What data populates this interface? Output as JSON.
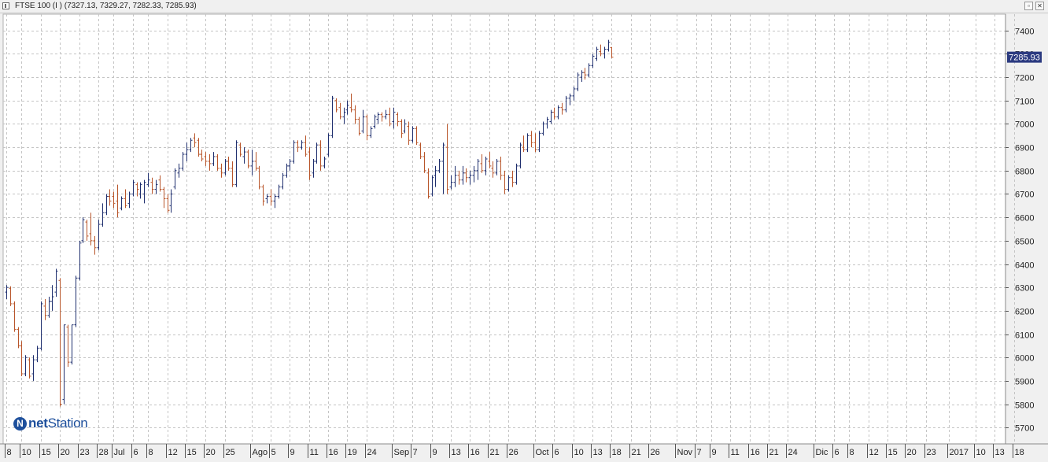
{
  "window": {
    "title": "FTSE 100 (I ) (7327.13, 7329.27, 7282.33, 7285.93)",
    "restore_glyph": "▫",
    "close_glyph": "✕"
  },
  "logo": {
    "mark": "N",
    "text_bold": "net",
    "text_rest": "Station"
  },
  "colors": {
    "up": "#1f2f6e",
    "down": "#b8552a",
    "grid": "#c4c4c4",
    "last_price_bg": "#2b3a80"
  },
  "chart_data": {
    "type": "bar",
    "title": "FTSE 100 (I )",
    "ohlc_last": {
      "open": 7327.13,
      "high": 7329.27,
      "low": 7282.33,
      "close": 7285.93
    },
    "last_price_label": "7285.93",
    "ylim": [
      5630,
      7470
    ],
    "y_ticks": [
      5700,
      5800,
      5900,
      6000,
      6100,
      6200,
      6300,
      6400,
      6500,
      6600,
      6700,
      6800,
      6900,
      7000,
      7100,
      7200,
      7300,
      7400
    ],
    "x_ticks": [
      {
        "label": "8",
        "bar": 0
      },
      {
        "label": "10",
        "bar": 4
      },
      {
        "label": "15",
        "bar": 9
      },
      {
        "label": "20",
        "bar": 14
      },
      {
        "label": "23",
        "bar": 19
      },
      {
        "label": "28",
        "bar": 24
      },
      {
        "label": "Jul",
        "bar": 28
      },
      {
        "label": "6",
        "bar": 33
      },
      {
        "label": "8",
        "bar": 37
      },
      {
        "label": "12",
        "bar": 42
      },
      {
        "label": "15",
        "bar": 47
      },
      {
        "label": "20",
        "bar": 52
      },
      {
        "label": "25",
        "bar": 57
      },
      {
        "label": "Ago",
        "bar": 64
      },
      {
        "label": "5",
        "bar": 69
      },
      {
        "label": "9",
        "bar": 74
      },
      {
        "label": "11",
        "bar": 79
      },
      {
        "label": "16",
        "bar": 84
      },
      {
        "label": "19",
        "bar": 89
      },
      {
        "label": "24",
        "bar": 94
      },
      {
        "label": "Sep",
        "bar": 101
      },
      {
        "label": "7",
        "bar": 106
      },
      {
        "label": "9",
        "bar": 111
      },
      {
        "label": "13",
        "bar": 116
      },
      {
        "label": "16",
        "bar": 121
      },
      {
        "label": "21",
        "bar": 126
      },
      {
        "label": "26",
        "bar": 131
      },
      {
        "label": "Oct",
        "bar": 138
      },
      {
        "label": "6",
        "bar": 143
      },
      {
        "label": "10",
        "bar": 148
      },
      {
        "label": "13",
        "bar": 153
      },
      {
        "label": "18",
        "bar": 158
      },
      {
        "label": "21",
        "bar": 163
      },
      {
        "label": "26",
        "bar": 168
      },
      {
        "label": "Nov",
        "bar": 175
      },
      {
        "label": "7",
        "bar": 180
      },
      {
        "label": "9",
        "bar": 184
      },
      {
        "label": "11",
        "bar": 189
      },
      {
        "label": "16",
        "bar": 194
      },
      {
        "label": "21",
        "bar": 199
      },
      {
        "label": "24",
        "bar": 204
      },
      {
        "label": "Dic",
        "bar": 211
      },
      {
        "label": "6",
        "bar": 216
      },
      {
        "label": "8",
        "bar": 220
      },
      {
        "label": "12",
        "bar": 225
      },
      {
        "label": "15",
        "bar": 230
      },
      {
        "label": "20",
        "bar": 235
      },
      {
        "label": "23",
        "bar": 240
      },
      {
        "label": "2017",
        "bar": 246
      },
      {
        "label": "10",
        "bar": 253
      },
      {
        "label": "13",
        "bar": 258
      },
      {
        "label": "18",
        "bar": 263
      }
    ],
    "series": [
      {
        "name": "FTSE 100",
        "style": "ohlc",
        "values": [
          [
            6280,
            6310,
            6250,
            6300
          ],
          [
            6295,
            6305,
            6220,
            6230
          ],
          [
            6230,
            6240,
            6110,
            6120
          ],
          [
            6120,
            6130,
            6040,
            6050
          ],
          [
            6050,
            6070,
            5920,
            5930
          ],
          [
            5930,
            6010,
            5920,
            6000
          ],
          [
            5990,
            6000,
            5910,
            5920
          ],
          [
            5930,
            6010,
            5900,
            5990
          ],
          [
            5990,
            6050,
            5980,
            6040
          ],
          [
            6040,
            6240,
            6030,
            6230
          ],
          [
            6220,
            6250,
            6160,
            6180
          ],
          [
            6180,
            6260,
            6170,
            6240
          ],
          [
            6240,
            6310,
            6200,
            6260
          ],
          [
            6280,
            6380,
            6260,
            6370
          ],
          [
            6330,
            6340,
            5790,
            5800
          ],
          [
            5820,
            6140,
            5800,
            6140
          ],
          [
            6130,
            6140,
            5960,
            5980
          ],
          [
            5980,
            6140,
            5970,
            6140
          ],
          [
            6140,
            6350,
            6130,
            6340
          ],
          [
            6340,
            6500,
            6330,
            6490
          ],
          [
            6500,
            6600,
            6490,
            6590
          ],
          [
            6580,
            6590,
            6500,
            6520
          ],
          [
            6530,
            6620,
            6480,
            6500
          ],
          [
            6500,
            6520,
            6440,
            6470
          ],
          [
            6470,
            6590,
            6460,
            6570
          ],
          [
            6570,
            6660,
            6560,
            6620
          ],
          [
            6620,
            6700,
            6610,
            6690
          ],
          [
            6690,
            6720,
            6650,
            6670
          ],
          [
            6690,
            6710,
            6640,
            6660
          ],
          [
            6670,
            6740,
            6600,
            6620
          ],
          [
            6640,
            6690,
            6630,
            6680
          ],
          [
            6680,
            6720,
            6640,
            6650
          ],
          [
            6660,
            6710,
            6640,
            6700
          ],
          [
            6700,
            6760,
            6690,
            6750
          ],
          [
            6740,
            6750,
            6690,
            6720
          ],
          [
            6700,
            6750,
            6680,
            6740
          ],
          [
            6700,
            6760,
            6660,
            6750
          ],
          [
            6740,
            6790,
            6730,
            6760
          ],
          [
            6750,
            6770,
            6700,
            6720
          ],
          [
            6720,
            6760,
            6700,
            6740
          ],
          [
            6760,
            6780,
            6710,
            6720
          ],
          [
            6720,
            6730,
            6640,
            6680
          ],
          [
            6680,
            6700,
            6620,
            6630
          ],
          [
            6650,
            6720,
            6620,
            6700
          ],
          [
            6730,
            6810,
            6720,
            6800
          ],
          [
            6790,
            6830,
            6770,
            6810
          ],
          [
            6810,
            6880,
            6800,
            6870
          ],
          [
            6870,
            6920,
            6840,
            6890
          ],
          [
            6890,
            6940,
            6880,
            6930
          ],
          [
            6940,
            6960,
            6900,
            6920
          ],
          [
            6930,
            6940,
            6860,
            6870
          ],
          [
            6870,
            6890,
            6840,
            6850
          ],
          [
            6860,
            6880,
            6820,
            6840
          ],
          [
            6840,
            6870,
            6800,
            6830
          ],
          [
            6830,
            6880,
            6820,
            6860
          ],
          [
            6860,
            6870,
            6800,
            6810
          ],
          [
            6810,
            6830,
            6770,
            6790
          ],
          [
            6790,
            6850,
            6780,
            6840
          ],
          [
            6840,
            6860,
            6800,
            6810
          ],
          [
            6810,
            6840,
            6730,
            6740
          ],
          [
            6740,
            6930,
            6730,
            6920
          ],
          [
            6910,
            6920,
            6860,
            6870
          ],
          [
            6860,
            6900,
            6830,
            6880
          ],
          [
            6880,
            6890,
            6810,
            6820
          ],
          [
            6820,
            6890,
            6780,
            6840
          ],
          [
            6840,
            6880,
            6800,
            6810
          ],
          [
            6810,
            6820,
            6720,
            6730
          ],
          [
            6730,
            6740,
            6650,
            6670
          ],
          [
            6680,
            6700,
            6660,
            6690
          ],
          [
            6690,
            6720,
            6650,
            6670
          ],
          [
            6670,
            6700,
            6640,
            6690
          ],
          [
            6690,
            6740,
            6680,
            6730
          ],
          [
            6730,
            6790,
            6720,
            6780
          ],
          [
            6780,
            6830,
            6770,
            6820
          ],
          [
            6820,
            6850,
            6800,
            6840
          ],
          [
            6840,
            6930,
            6830,
            6920
          ],
          [
            6920,
            6930,
            6880,
            6900
          ],
          [
            6900,
            6930,
            6890,
            6920
          ],
          [
            6920,
            6950,
            6860,
            6870
          ],
          [
            6880,
            6900,
            6760,
            6780
          ],
          [
            6790,
            6850,
            6770,
            6840
          ],
          [
            6840,
            6920,
            6830,
            6910
          ],
          [
            6910,
            6930,
            6800,
            6820
          ],
          [
            6820,
            6860,
            6810,
            6850
          ],
          [
            6870,
            6960,
            6860,
            6950
          ],
          [
            6950,
            7120,
            6940,
            7110
          ],
          [
            7100,
            7110,
            7050,
            7060
          ],
          [
            7070,
            7090,
            7020,
            7030
          ],
          [
            7030,
            7070,
            7000,
            7050
          ],
          [
            7060,
            7100,
            7040,
            7080
          ],
          [
            7070,
            7130,
            7050,
            7060
          ],
          [
            7060,
            7080,
            7000,
            7020
          ],
          [
            7020,
            7030,
            6950,
            6960
          ],
          [
            6970,
            7060,
            6960,
            7030
          ],
          [
            7030,
            7040,
            6930,
            6950
          ],
          [
            6950,
            6990,
            6940,
            6980
          ],
          [
            6990,
            7040,
            6980,
            7030
          ],
          [
            7020,
            7050,
            7000,
            7040
          ],
          [
            7040,
            7050,
            7010,
            7030
          ],
          [
            7030,
            7060,
            7020,
            7040
          ],
          [
            7040,
            7070,
            6990,
            7000
          ],
          [
            7010,
            7070,
            6980,
            7050
          ],
          [
            7040,
            7050,
            6990,
            7010
          ],
          [
            7010,
            7020,
            6940,
            6960
          ],
          [
            6970,
            7020,
            6960,
            7000
          ],
          [
            6990,
            7010,
            6910,
            6930
          ],
          [
            6930,
            6990,
            6920,
            6980
          ],
          [
            6980,
            6990,
            6910,
            6920
          ],
          [
            6910,
            6920,
            6850,
            6860
          ],
          [
            6860,
            6880,
            6790,
            6800
          ],
          [
            6790,
            6810,
            6680,
            6690
          ],
          [
            6700,
            6780,
            6690,
            6770
          ],
          [
            6780,
            6820,
            6730,
            6800
          ],
          [
            6800,
            6850,
            6790,
            6840
          ],
          [
            6840,
            6920,
            6700,
            6910
          ],
          [
            6900,
            7000,
            6700,
            6720
          ],
          [
            6730,
            6780,
            6720,
            6750
          ],
          [
            6750,
            6820,
            6730,
            6780
          ],
          [
            6780,
            6800,
            6740,
            6760
          ],
          [
            6760,
            6820,
            6740,
            6790
          ],
          [
            6790,
            6810,
            6750,
            6770
          ],
          [
            6770,
            6800,
            6740,
            6780
          ],
          [
            6780,
            6820,
            6750,
            6800
          ],
          [
            6800,
            6850,
            6760,
            6840
          ],
          [
            6830,
            6870,
            6790,
            6800
          ],
          [
            6800,
            6860,
            6780,
            6850
          ],
          [
            6840,
            6880,
            6810,
            6820
          ],
          [
            6810,
            6840,
            6770,
            6790
          ],
          [
            6790,
            6850,
            6780,
            6840
          ],
          [
            6840,
            6860,
            6760,
            6780
          ],
          [
            6780,
            6800,
            6700,
            6720
          ],
          [
            6720,
            6780,
            6710,
            6770
          ],
          [
            6770,
            6800,
            6730,
            6750
          ],
          [
            6750,
            6830,
            6740,
            6820
          ],
          [
            6820,
            6920,
            6810,
            6910
          ],
          [
            6900,
            6950,
            6880,
            6890
          ],
          [
            6890,
            6960,
            6880,
            6950
          ],
          [
            6950,
            6970,
            6900,
            6920
          ],
          [
            6920,
            6960,
            6880,
            6890
          ],
          [
            6890,
            6970,
            6880,
            6960
          ],
          [
            6960,
            7010,
            6950,
            7000
          ],
          [
            7000,
            7030,
            6980,
            7020
          ],
          [
            7010,
            7060,
            7000,
            7050
          ],
          [
            7050,
            7070,
            7020,
            7030
          ],
          [
            7030,
            7080,
            7020,
            7070
          ],
          [
            7070,
            7090,
            7040,
            7060
          ],
          [
            7060,
            7120,
            7050,
            7110
          ],
          [
            7110,
            7130,
            7080,
            7120
          ],
          [
            7120,
            7160,
            7100,
            7150
          ],
          [
            7150,
            7220,
            7140,
            7210
          ],
          [
            7200,
            7230,
            7180,
            7220
          ],
          [
            7220,
            7240,
            7190,
            7210
          ],
          [
            7210,
            7260,
            7200,
            7250
          ],
          [
            7250,
            7300,
            7240,
            7290
          ],
          [
            7280,
            7330,
            7270,
            7320
          ],
          [
            7310,
            7340,
            7290,
            7300
          ],
          [
            7300,
            7330,
            7280,
            7320
          ],
          [
            7320,
            7360,
            7310,
            7350
          ],
          [
            7327.13,
            7329.27,
            7282.33,
            7285.93
          ]
        ]
      }
    ]
  }
}
